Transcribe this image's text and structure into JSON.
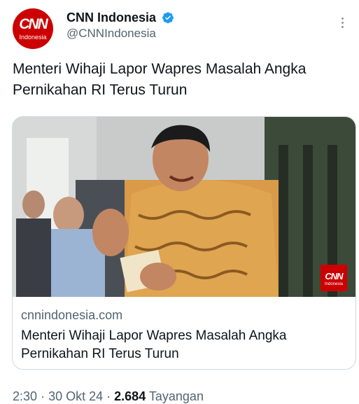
{
  "account": {
    "display_name": "CNN Indonesia",
    "handle": "@CNNIndonesia",
    "avatar_logo": "CNN",
    "avatar_sub": "Indonesia",
    "verified_icon": "verified-badge-icon"
  },
  "tweet": {
    "text": "Menteri Wihaji Lapor Wapres Masalah Angka Pernikahan RI Terus Turun"
  },
  "card": {
    "badge_logo": "CNN",
    "badge_sub": "Indonesia",
    "domain": "cnnindonesia.com",
    "title": "Menteri Wihaji Lapor Wapres Masalah Angka Pernikahan RI Terus Turun"
  },
  "meta": {
    "time": "2:30",
    "separator": "·",
    "date": "30 Okt 24",
    "views": "2.684",
    "views_label": "Tayangan"
  },
  "colors": {
    "brand_red": "#cc0000",
    "verified_blue": "#1d9bf0",
    "secondary_text": "#536471"
  }
}
